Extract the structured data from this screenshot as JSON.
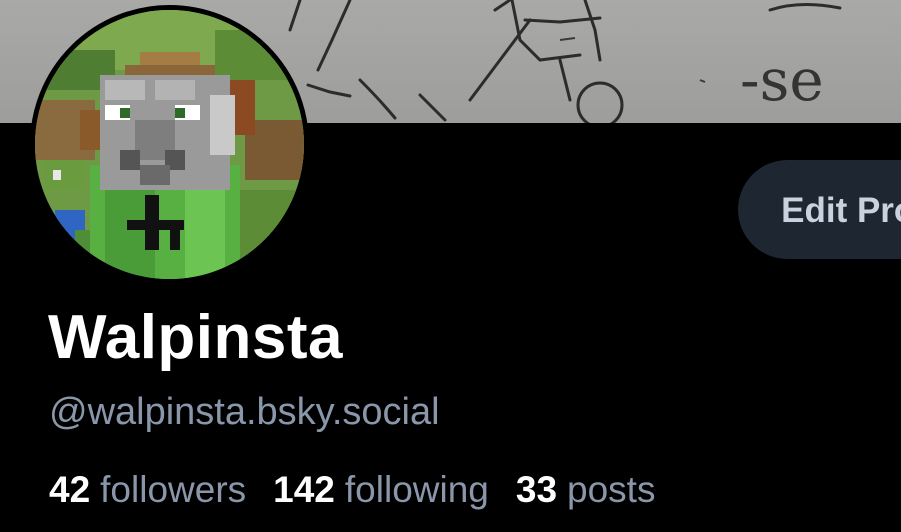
{
  "profile": {
    "display_name": "Walpinsta",
    "handle": "@walpinsta.bsky.social",
    "edit_label": "Edit Profile",
    "stats": [
      {
        "count": "42",
        "label": "followers"
      },
      {
        "count": "142",
        "label": "following"
      },
      {
        "count": "33",
        "label": "posts"
      }
    ]
  },
  "banner": {
    "scribble_text": "-se"
  },
  "colors": {
    "background": "#000000",
    "muted_text": "#8a97aa",
    "button_bg": "#1e2631",
    "button_text": "#c9d2de"
  }
}
